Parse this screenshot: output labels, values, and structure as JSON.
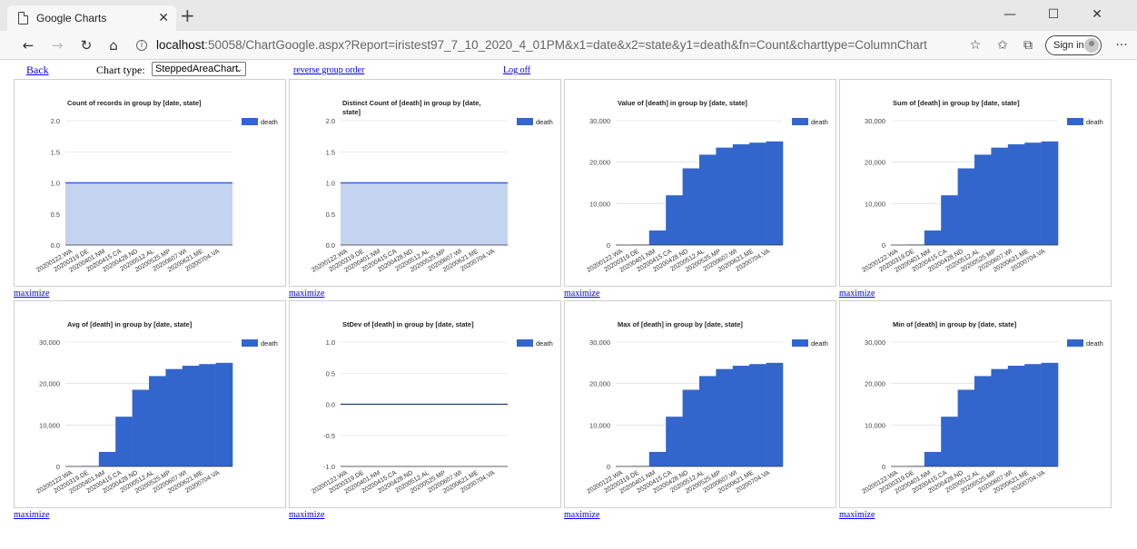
{
  "browser": {
    "tab_title": "Google Charts",
    "tab_close": "✕",
    "new_tab": "+",
    "url_host": "localhost",
    "url_rest": ":50058/ChartGoogle.aspx?Report=iristest97_7_10_2020_4_01PM&x1=date&x2=state&y1=death&fn=Count&charttype=ColumnChart",
    "sign_in": "Sign in",
    "window_controls": [
      "—",
      "☐",
      "✕"
    ],
    "nav": {
      "back": "←",
      "forward": "→",
      "refresh": "↻",
      "home": "⌂",
      "info": "i"
    },
    "right_icons": {
      "favorite": "☆",
      "favorites_bar": "✩",
      "collections": "⧉",
      "more": "···"
    }
  },
  "page": {
    "back_link": "Back",
    "chart_type_label": "Chart type:",
    "chart_type_selected": "SteppedAreaChart",
    "chart_type_arrow": "⌄",
    "reverse_link": "reverse group order",
    "logoff_link": "Log off",
    "maximize_label": "maximize"
  },
  "colors": {
    "fill_blue": "#3366cc",
    "light_fill": "#c4d3ef",
    "link": "#0000ee"
  },
  "x_tick_labels": [
    "20200122.WA",
    "20200319.DE",
    "20200401.NM",
    "20200415.CA",
    "20200428.ND",
    "20200512.AL",
    "20200525.MP",
    "20200607.WI",
    "20200621.ME",
    "20200704.VA"
  ],
  "chart_data": [
    {
      "type": "area",
      "subtype": "stepped",
      "title": "Count of records in group by [date, state]",
      "legend": "death",
      "legend_position": "right",
      "ylim": [
        0,
        2.0
      ],
      "yticks": [
        "2.0",
        "1.5",
        "1.0",
        "0.5",
        "0.0"
      ],
      "shape": "flat",
      "value": 1.0,
      "grid": true
    },
    {
      "type": "area",
      "subtype": "stepped",
      "title": "Distinct Count of [death] in group by [date, state]",
      "legend": "death",
      "legend_position": "right",
      "ylim": [
        0,
        2.0
      ],
      "yticks": [
        "2.0",
        "1.5",
        "1.0",
        "0.5",
        "0.0"
      ],
      "shape": "flat",
      "value": 1.0,
      "grid": true
    },
    {
      "type": "area",
      "subtype": "stepped",
      "title": "Value of [death] in group by [date, state]",
      "legend": "death",
      "legend_position": "right",
      "ylim": [
        0,
        30000
      ],
      "yticks": [
        "30,000",
        "20,000",
        "10,000",
        "0"
      ],
      "shape": "cumulative",
      "grid": true,
      "x": [
        "20200122.WA",
        "20200319.DE",
        "20200401.NM",
        "20200415.CA",
        "20200428.ND",
        "20200512.AL",
        "20200525.MP",
        "20200607.WI",
        "20200621.ME",
        "20200704.VA"
      ],
      "values": [
        0,
        100,
        3500,
        12000,
        18500,
        21800,
        23500,
        24300,
        24700,
        25000
      ]
    },
    {
      "type": "area",
      "subtype": "stepped",
      "title": "Sum of [death] in group by [date, state]",
      "legend": "death",
      "legend_position": "right",
      "ylim": [
        0,
        30000
      ],
      "yticks": [
        "30,000",
        "20,000",
        "10,000",
        "0"
      ],
      "shape": "cumulative",
      "grid": true,
      "x": [
        "20200122.WA",
        "20200319.DE",
        "20200401.NM",
        "20200415.CA",
        "20200428.ND",
        "20200512.AL",
        "20200525.MP",
        "20200607.WI",
        "20200621.ME",
        "20200704.VA"
      ],
      "values": [
        0,
        100,
        3500,
        12000,
        18500,
        21800,
        23500,
        24300,
        24700,
        25000
      ]
    },
    {
      "type": "area",
      "subtype": "stepped",
      "title": "Avg of [death] in group by [date, state]",
      "legend": "death",
      "legend_position": "right",
      "ylim": [
        0,
        30000
      ],
      "yticks": [
        "30,000",
        "20,000",
        "10,000",
        "0"
      ],
      "shape": "cumulative",
      "grid": true,
      "x": [
        "20200122.WA",
        "20200319.DE",
        "20200401.NM",
        "20200415.CA",
        "20200428.ND",
        "20200512.AL",
        "20200525.MP",
        "20200607.WI",
        "20200621.ME",
        "20200704.VA"
      ],
      "values": [
        0,
        100,
        3500,
        12000,
        18500,
        21800,
        23500,
        24300,
        24700,
        25000
      ]
    },
    {
      "type": "area",
      "subtype": "stepped",
      "title": "StDev of [death] in group by [date, state]",
      "legend": "death",
      "legend_position": "right",
      "ylim": [
        -1.0,
        1.0
      ],
      "yticks": [
        "1.0",
        "0.5",
        "0.0",
        "-0.5",
        "-1.0"
      ],
      "shape": "zero",
      "value": 0,
      "grid": true
    },
    {
      "type": "area",
      "subtype": "stepped",
      "title": "Max of [death] in group by [date, state]",
      "legend": "death",
      "legend_position": "right",
      "ylim": [
        0,
        30000
      ],
      "yticks": [
        "30,000",
        "20,000",
        "10,000",
        "0"
      ],
      "shape": "cumulative",
      "grid": true,
      "x": [
        "20200122.WA",
        "20200319.DE",
        "20200401.NM",
        "20200415.CA",
        "20200428.ND",
        "20200512.AL",
        "20200525.MP",
        "20200607.WI",
        "20200621.ME",
        "20200704.VA"
      ],
      "values": [
        0,
        100,
        3500,
        12000,
        18500,
        21800,
        23500,
        24300,
        24700,
        25000
      ]
    },
    {
      "type": "area",
      "subtype": "stepped",
      "title": "Min of [death] in group by [date, state]",
      "legend": "death",
      "legend_position": "right",
      "ylim": [
        0,
        30000
      ],
      "yticks": [
        "30,000",
        "20,000",
        "10,000",
        "0"
      ],
      "shape": "cumulative",
      "grid": true,
      "x": [
        "20200122.WA",
        "20200319.DE",
        "20200401.NM",
        "20200415.CA",
        "20200428.ND",
        "20200512.AL",
        "20200525.MP",
        "20200607.WI",
        "20200621.ME",
        "20200704.VA"
      ],
      "values": [
        0,
        100,
        3500,
        12000,
        18500,
        21800,
        23500,
        24300,
        24700,
        25000
      ]
    }
  ]
}
